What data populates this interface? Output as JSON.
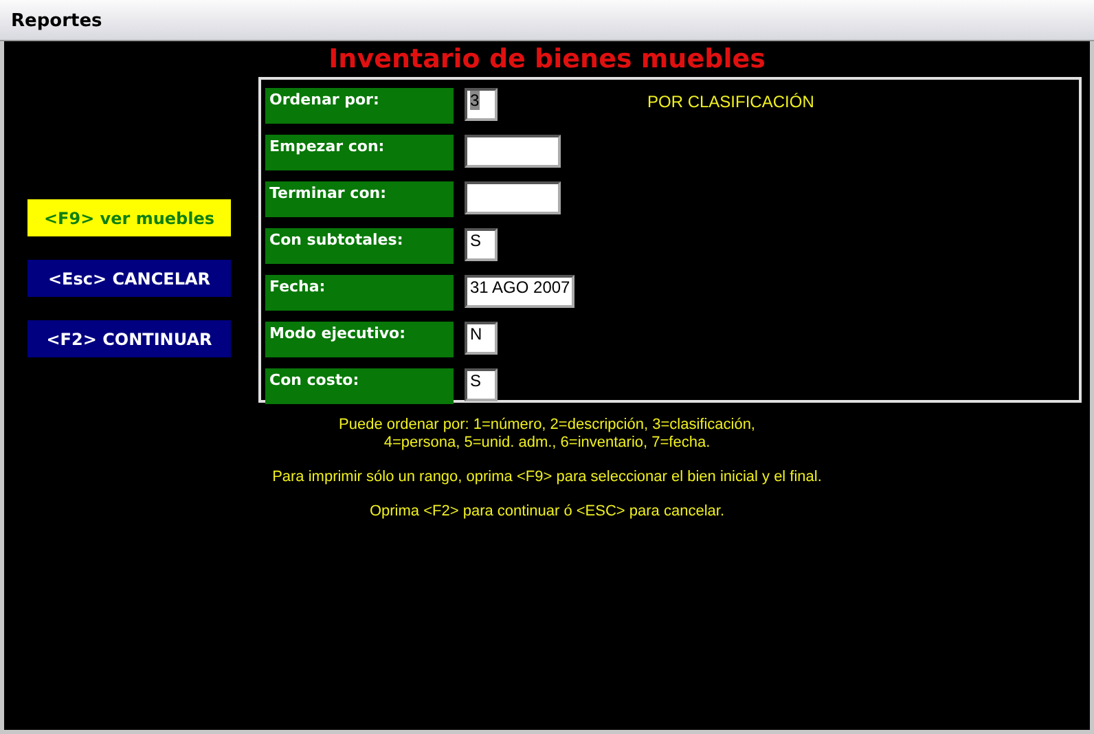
{
  "window": {
    "title": "Reportes"
  },
  "heading": "Inventario de bienes muebles",
  "buttons": [
    {
      "label": "<F9> ver muebles",
      "highlighted": true
    },
    {
      "label": "<Esc> CANCELAR",
      "highlighted": false
    },
    {
      "label": "<F2> CONTINUAR",
      "highlighted": false
    }
  ],
  "fields": [
    {
      "label": "Ordenar por:",
      "value": "3",
      "kind": "short",
      "text_selected": true
    },
    {
      "label": "Empezar con:",
      "kind": "long"
    },
    {
      "label": "Terminar con:",
      "kind": "long"
    },
    {
      "label": "Con subtotales:",
      "value": "S",
      "kind": "short",
      "text_selected": false
    },
    {
      "label": "Fecha:",
      "value": "31 AGO 2007",
      "kind": "date",
      "text_selected": false
    },
    {
      "label": "Modo ejecutivo:",
      "value": "N",
      "kind": "short",
      "text_selected": false
    },
    {
      "label": "Con costo:",
      "value": "S",
      "kind": "short",
      "text_selected": false
    }
  ],
  "order_caption": "POR CLASIFICACIÓN",
  "notes": [
    "Puede ordenar por: 1=número, 2=descripción, 3=clasificación,\n4=persona, 5=unid. adm., 6=inventario, 7=fecha.",
    "Para imprimir sólo un rango, oprima <F9> para seleccionar el bien inicial y el final.",
    "Oprima <F2> para continuar ó <ESC> para cancelar."
  ]
}
